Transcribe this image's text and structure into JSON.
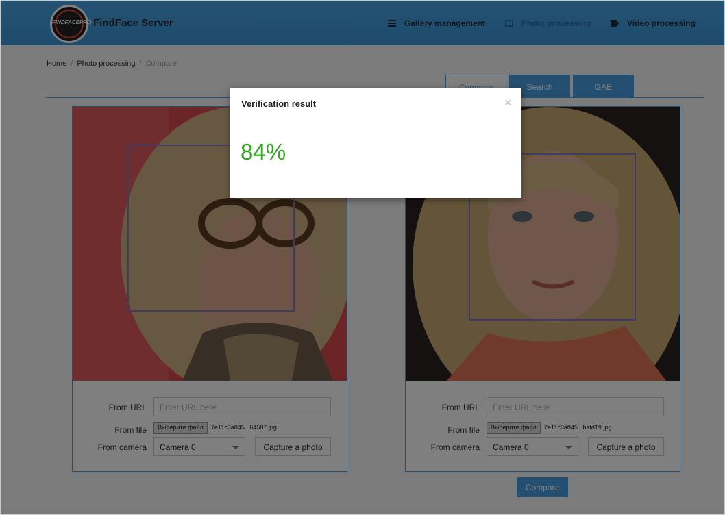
{
  "header": {
    "logo_text": "FINDFACEPRO",
    "brand": "FindFace Server",
    "nav": [
      {
        "label": "Gallery management",
        "icon": "list-icon",
        "active": false
      },
      {
        "label": "Photo processing",
        "icon": "image-icon",
        "active": true
      },
      {
        "label": "Video processing",
        "icon": "video-camera-icon",
        "active": false
      }
    ]
  },
  "breadcrumb": [
    "Home",
    "Photo processing",
    "Compare"
  ],
  "tabs": [
    {
      "label": "Compare",
      "active": true
    },
    {
      "label": "Search",
      "active": false
    },
    {
      "label": "GAE",
      "active": false
    }
  ],
  "form": {
    "url_label": "From URL",
    "url_placeholder": "Enter URL here",
    "file_label": "From file",
    "file_button": "Выберите файл",
    "camera_label": "From camera",
    "camera_value": "Camera 0",
    "capture_label": "Capture a photo"
  },
  "panels": [
    {
      "file_name": "7e11c3a845...64587.jpg"
    },
    {
      "file_name": "7e11c3a845...bafd19.jpg"
    }
  ],
  "compare_button": "Compare",
  "modal": {
    "title": "Verification result",
    "close": "×",
    "value": "84%",
    "value_color": "#2faa1f"
  }
}
